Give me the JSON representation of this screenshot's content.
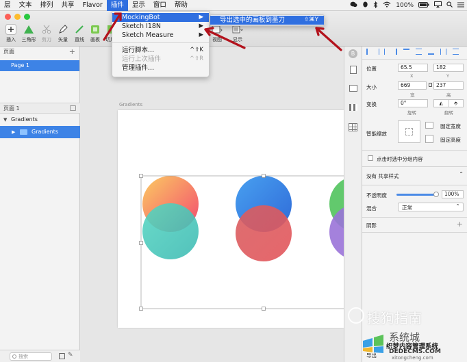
{
  "menubar": {
    "items": [
      "层",
      "文本",
      "排列",
      "共享",
      "Flavor",
      "插件",
      "显示",
      "窗口",
      "帮助"
    ],
    "active_index": 5,
    "status_right": "100%",
    "status_icons": [
      "wechat-icon",
      "qq-icon",
      "bluetooth-icon",
      "wifi-icon",
      "battery-icon",
      "airplay-icon",
      "search-icon",
      "list-icon"
    ]
  },
  "toolbar": {
    "buttons": [
      {
        "label": "插入",
        "icon": "plus-icon"
      },
      {
        "label": "三角形",
        "icon": "triangle-icon"
      },
      {
        "label": "剪刀",
        "icon": "scissors-icon"
      },
      {
        "label": "矢量",
        "icon": "pen-icon"
      },
      {
        "label": "直线",
        "icon": "line-icon"
      },
      {
        "label": "画板",
        "icon": "artboard-icon"
      },
      {
        "label": "切片",
        "icon": "slice-icon"
      }
    ],
    "right_buttons": [
      {
        "label": "视图",
        "icon": "view-icon"
      },
      {
        "label": "显示",
        "icon": "display-icon"
      }
    ]
  },
  "plugin_menu": {
    "items": [
      {
        "label": "MockingBot",
        "shortcut": "▶",
        "highlighted": true,
        "disabled": false
      },
      {
        "label": "Sketch I18N",
        "shortcut": "▶",
        "highlighted": false,
        "disabled": false
      },
      {
        "label": "Sketch Measure",
        "shortcut": "▶",
        "highlighted": false,
        "disabled": false
      },
      {
        "label": "运行脚本...",
        "shortcut": "^⇧K",
        "highlighted": false,
        "disabled": false
      },
      {
        "label": "运行上次插件",
        "shortcut": "^⇧R",
        "highlighted": false,
        "disabled": true
      },
      {
        "label": "管理插件...",
        "shortcut": "",
        "highlighted": false,
        "disabled": false
      }
    ]
  },
  "submenu": {
    "label": "导出选中的画板到墨刀",
    "shortcut": "⇧⌘Y"
  },
  "sidebar": {
    "pages_header": "页面",
    "pages": [
      "Page 1"
    ],
    "layers_header": "页面 1",
    "layers": [
      {
        "label": "Gradients",
        "selected": false
      },
      {
        "label": "Gradients",
        "selected": true
      }
    ],
    "search_placeholder": "搜索"
  },
  "canvas": {
    "artboard_title": "Gradients",
    "colors": {
      "orange_top": "#fbc365",
      "pink_bottom": "#f4586e",
      "teal": "#4fcdc0",
      "blue": "#3b7de0",
      "red": "#e15a5e",
      "green": "#63c86a",
      "purple": "#9b72d6"
    }
  },
  "inspector": {
    "position_label": "位置",
    "x_value": "65.5",
    "y_value": "182",
    "x_label": "X",
    "y_label": "Y",
    "size_label": "大小",
    "width_value": "669",
    "height_value": "237",
    "width_label": "宽",
    "height_label": "高",
    "transform_label": "变换",
    "rotate_value": "0°",
    "rotate_label": "旋转",
    "flip_label": "翻转",
    "smart_resize_label": "智能缩放",
    "fix_width_label": "固定宽度",
    "fix_height_label": "固定高度",
    "click_select_label": "点击时选中分组内容",
    "shared_style_label": "没有 共享样式",
    "opacity_label": "不透明度",
    "opacity_value": "100%",
    "opacity_level": 1.0,
    "blend_label": "混合",
    "blend_value": "正常",
    "shadow_label": "阴影",
    "export_label": "导出"
  },
  "watermarks": {
    "sogou": "搜狗指南",
    "site_cn": "系统城",
    "site_line": "织梦内容管理系统",
    "site_url": "DEDECMS.COM",
    "site_url2": "xitongcheng.com"
  }
}
